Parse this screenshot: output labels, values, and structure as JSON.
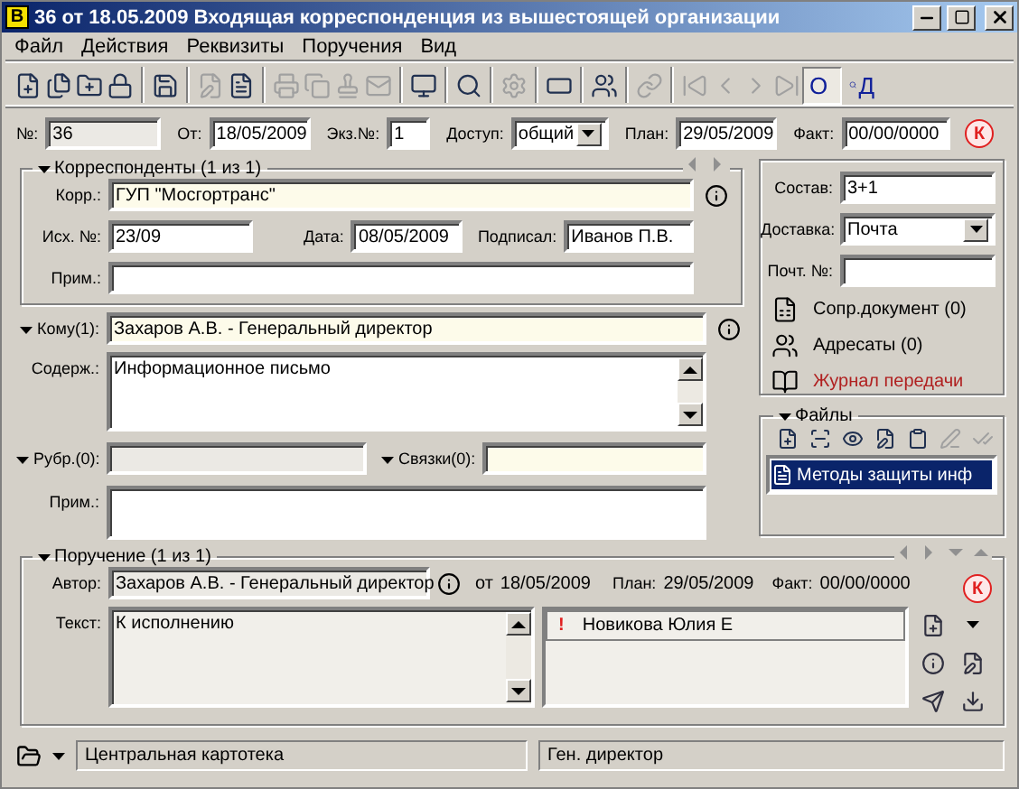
{
  "window": {
    "badge": "В",
    "title": "36 от 18.05.2009 Входящая корреспонденция из вышестоящей организации"
  },
  "menu": [
    "Файл",
    "Действия",
    "Реквизиты",
    "Поручения",
    "Вид"
  ],
  "toolbar": [
    {
      "kind": "new",
      "disabled": false
    },
    {
      "kind": "new_copy",
      "disabled": false
    },
    {
      "kind": "new_folder",
      "disabled": false
    },
    {
      "kind": "new_lock",
      "disabled": false
    },
    {
      "kind": "separator"
    },
    {
      "kind": "save",
      "disabled": false
    },
    {
      "kind": "separator"
    },
    {
      "kind": "edit",
      "disabled": true
    },
    {
      "kind": "doc",
      "disabled": false
    },
    {
      "kind": "separator"
    },
    {
      "kind": "print",
      "disabled": true
    },
    {
      "kind": "copy",
      "disabled": true
    },
    {
      "kind": "stamp",
      "disabled": true
    },
    {
      "kind": "mail",
      "disabled": true
    },
    {
      "kind": "separator"
    },
    {
      "kind": "monitor",
      "disabled": false
    },
    {
      "kind": "separator"
    },
    {
      "kind": "search",
      "disabled": false
    },
    {
      "kind": "separator"
    },
    {
      "kind": "gear",
      "disabled": true
    },
    {
      "kind": "separator"
    },
    {
      "kind": "field",
      "disabled": false
    },
    {
      "kind": "separator"
    },
    {
      "kind": "users",
      "disabled": false
    },
    {
      "kind": "separator"
    },
    {
      "kind": "link",
      "disabled": true
    },
    {
      "kind": "separator"
    },
    {
      "kind": "first",
      "disabled": true
    },
    {
      "kind": "prev",
      "disabled": true
    },
    {
      "kind": "next",
      "disabled": true
    },
    {
      "kind": "last",
      "disabled": true
    }
  ],
  "toolbar_toggles": [
    {
      "label": "О",
      "selected": true
    },
    {
      "label": "Д",
      "selected": false
    }
  ],
  "header_fields": [
    {
      "label": "№:",
      "value": "36",
      "disabled": true
    },
    {
      "label": "От:",
      "value": "18/05/2009",
      "disabled": false
    },
    {
      "label": "Экз.№:",
      "value": "1",
      "disabled": false
    },
    {
      "label": "Доступ:",
      "value": "общий",
      "disabled": false,
      "combo": true
    },
    {
      "label": "План:",
      "value": "29/05/2009",
      "disabled": false
    },
    {
      "label": "Факт:",
      "value": "00/00/0000",
      "disabled": false
    }
  ],
  "control_mark": "К",
  "correspondents": {
    "title": "Корреспонденты (1 из 1)",
    "korr": {
      "label": "Корр.:",
      "value": "ГУП \"Мосгортранс\"",
      "lookup": true
    },
    "out_no": {
      "label": "Исх. №:",
      "value": "23/09"
    },
    "date": {
      "label": "Дата:",
      "value": "08/05/2009"
    },
    "signed": {
      "label": "Подписал:",
      "value": "Иванов П.В."
    },
    "note": {
      "label": "Прим.:"
    }
  },
  "addressee": {
    "label": "Кому(1):",
    "value": "Захаров А.В. - Генеральный директор",
    "lookup": true
  },
  "content": {
    "label": "Содерж.:",
    "value": "Информационное письмо"
  },
  "rubrics": {
    "label": "Рубр.(0):",
    "disabled": true
  },
  "links": {
    "label": "Связки(0):",
    "lookup": true
  },
  "note": {
    "label": "Прим.:"
  },
  "details": {
    "composition": {
      "label": "Состав:",
      "value": "3+1"
    },
    "delivery": {
      "label": "Доставка:",
      "value": "Почта"
    },
    "post_no": {
      "label": "Почт. №:"
    },
    "actions": [
      {
        "kind": "doc",
        "label": "Сопр.документ (0)",
        "color": "#000000"
      },
      {
        "kind": "people",
        "label": "Адресаты (0)",
        "color": "#000000"
      },
      {
        "kind": "journal",
        "label": "Журнал передачи",
        "color": "#b02020"
      }
    ]
  },
  "files": {
    "title": "Файлы",
    "tools": [
      {
        "kind": "add",
        "disabled": false
      },
      {
        "kind": "scan",
        "disabled": false
      },
      {
        "kind": "view",
        "disabled": false
      },
      {
        "kind": "edit",
        "disabled": false
      },
      {
        "kind": "copy",
        "disabled": false
      },
      {
        "kind": "sign",
        "disabled": true
      },
      {
        "kind": "check",
        "disabled": true
      }
    ],
    "items": [
      {
        "name": "Методы защиты инф",
        "selected": true
      }
    ]
  },
  "assignment": {
    "title": "Поручение (1 из 1)",
    "author": {
      "label": "Автор:",
      "value": "Захаров А.В. - Генеральный директор"
    },
    "from_label": "от",
    "from_value": "18/05/2009",
    "plan_label": "План:",
    "plan_value": "29/05/2009",
    "fact_label": "Факт:",
    "fact_value": "00/00/0000",
    "control_mark": "К",
    "text": {
      "label": "Текст:",
      "value": "К исполнению"
    },
    "executors": [
      {
        "mark": "!",
        "name": "Новикова Юлия Е"
      }
    ]
  },
  "status_bar": [
    "Центральная картотека",
    "Ген. директор"
  ]
}
